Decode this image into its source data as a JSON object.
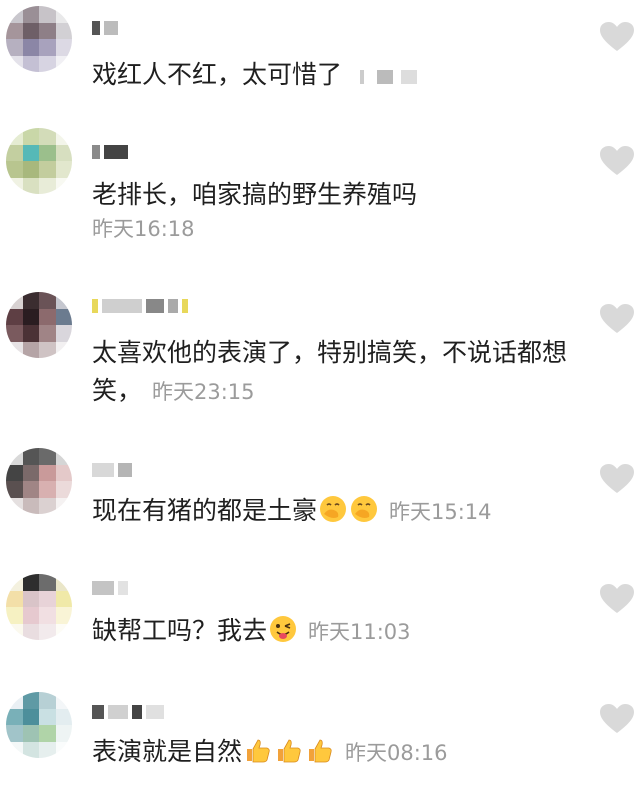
{
  "colors": {
    "text": "#1f1f1f",
    "time": "#9b9b9b",
    "heart": "#d9d9d9",
    "background": "#ffffff"
  },
  "comments": [
    {
      "text": "戏红人不红，太可惜了",
      "time": "",
      "emojis": [],
      "trailing_redaction": true
    },
    {
      "text": "老排长，咱家搞的野生养殖吗",
      "time": "昨天16:18",
      "emojis": []
    },
    {
      "text": "太喜欢他的表演了，特别搞笑，不说话都想笑，",
      "time": "昨天23:15",
      "emojis": []
    },
    {
      "text": "现在有猪的都是土豪",
      "time": "昨天15:14",
      "emojis": [
        "hand-over-mouth-emoji",
        "hand-over-mouth-emoji"
      ]
    },
    {
      "text": "缺帮工吗？我去",
      "time": "昨天11:03",
      "emojis": [
        "winking-tongue-emoji"
      ]
    },
    {
      "text": "表演就是自然",
      "time": "昨天08:16",
      "emojis": [
        "thumbs-up-emoji",
        "thumbs-up-emoji",
        "thumbs-up-emoji"
      ]
    }
  ],
  "icons": {
    "like": "heart-icon",
    "avatar": "pixelated-avatar-icon"
  }
}
